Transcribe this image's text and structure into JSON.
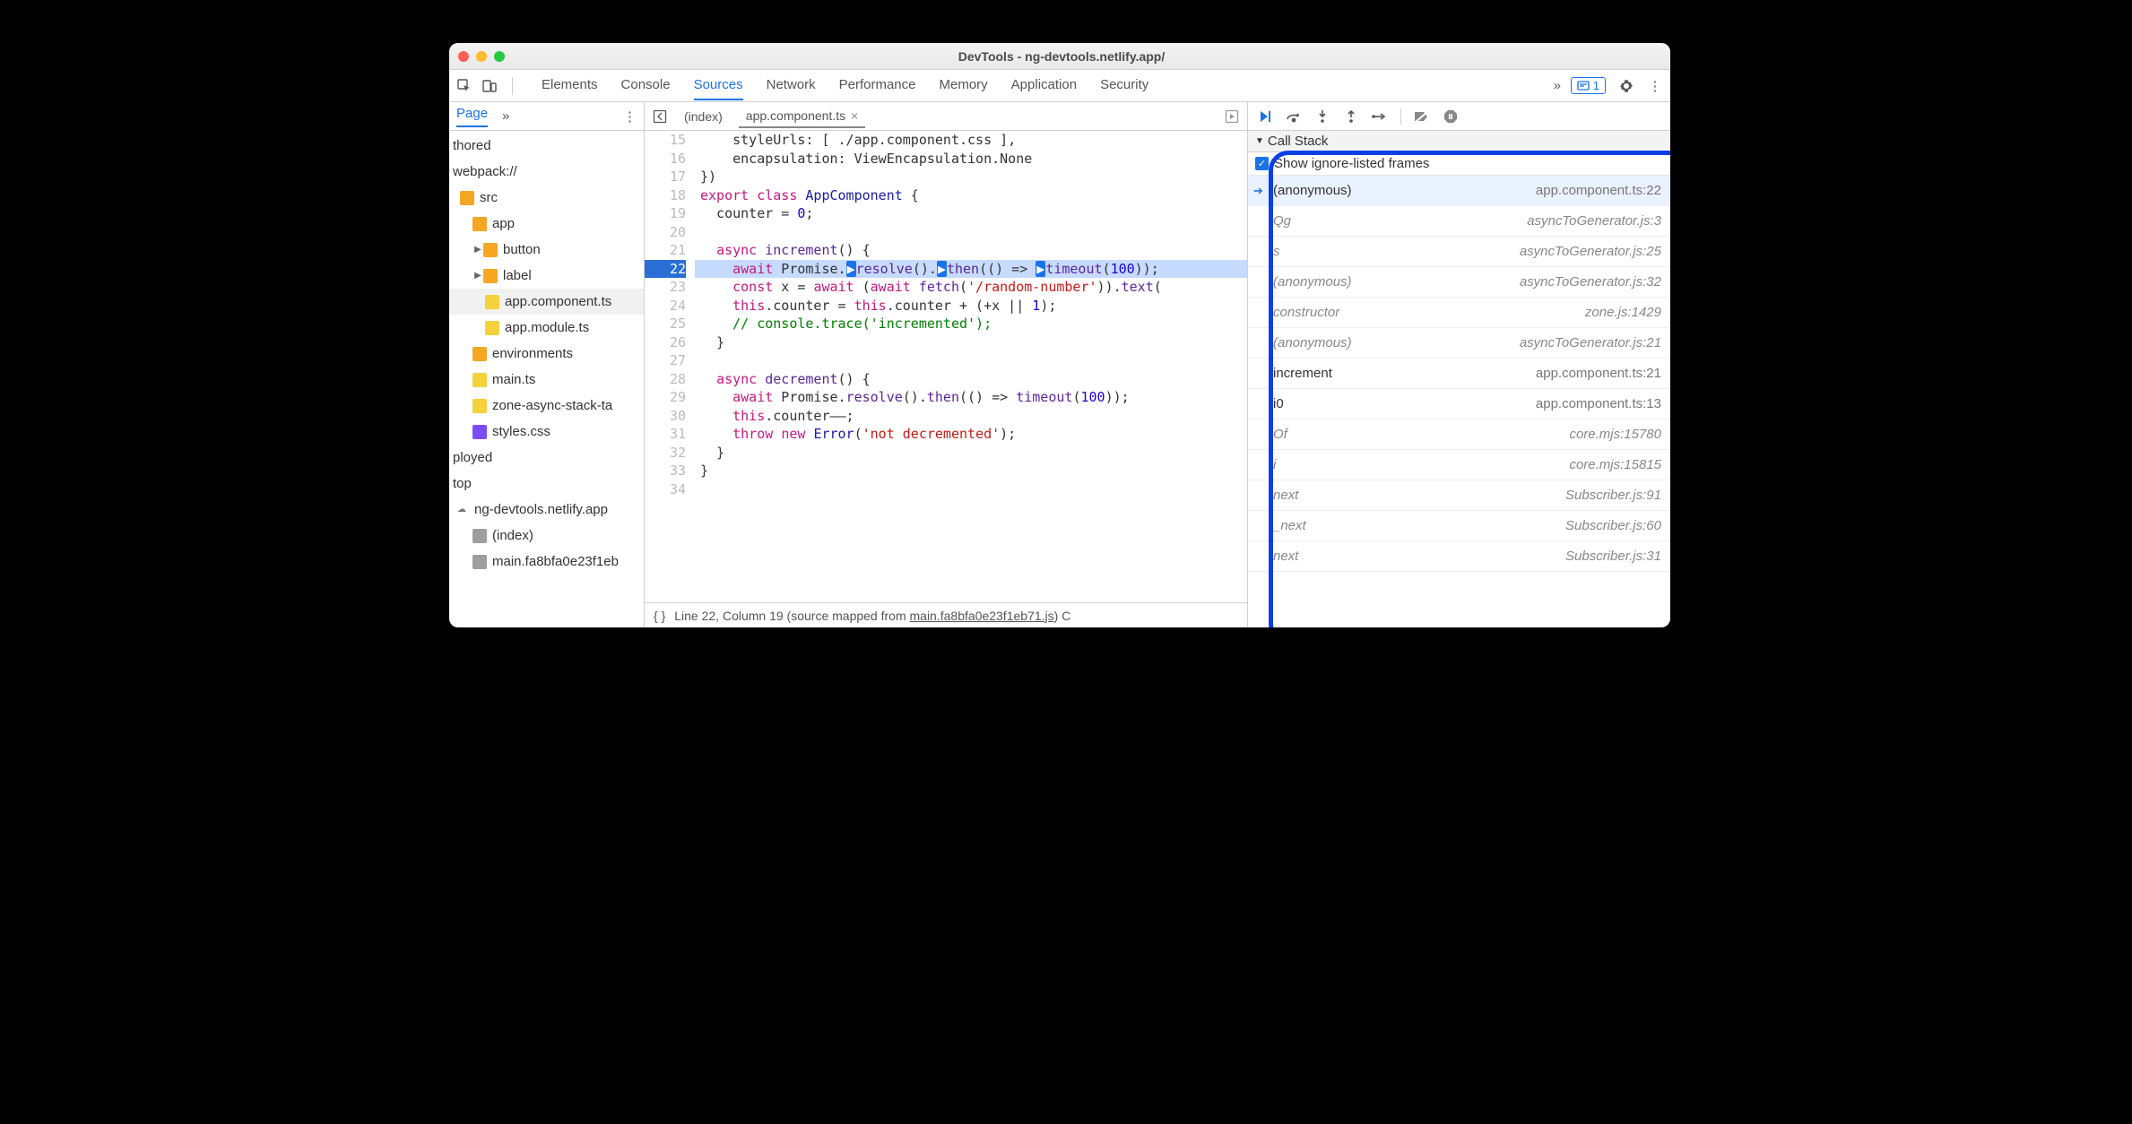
{
  "window": {
    "title": "DevTools - ng-devtools.netlify.app/"
  },
  "mainTabs": [
    "Elements",
    "Console",
    "Sources",
    "Network",
    "Performance",
    "Memory",
    "Application",
    "Security"
  ],
  "activeMainTab": "Sources",
  "issuesCount": "1",
  "navTabs": {
    "active": "Page"
  },
  "tree": {
    "authored": "thored",
    "webpack": "webpack://",
    "folders": {
      "src": "src",
      "app": "app",
      "button": "button",
      "label": "label",
      "environments": "environments"
    },
    "files": {
      "app_component": "app.component.ts",
      "app_module": "app.module.ts",
      "main_ts": "main.ts",
      "zone_stack": "zone-async-stack-ta",
      "styles_css": "styles.css",
      "index": "(index)",
      "main_hash": "main.fa8bfa0e23f1eb"
    },
    "ployed": "ployed",
    "top": "top",
    "domain": "ng-devtools.netlify.app"
  },
  "editor": {
    "tabs": {
      "index": "(index)",
      "active": "app.component.ts"
    },
    "startLine": 15,
    "currentLineIdx": 7,
    "lines": [
      {
        "html": "&nbsp;&nbsp;&nbsp;&nbsp;styleUrls: [&nbsp;./app.component.css&nbsp;],"
      },
      {
        "html": "&nbsp;&nbsp;&nbsp;&nbsp;encapsulation: ViewEncapsulation.None"
      },
      {
        "html": "})"
      },
      {
        "html": "<span class='kw'>export</span> <span class='kw'>class</span> <span class='cls'>AppComponent</span> {"
      },
      {
        "html": "&nbsp;&nbsp;counter = <span class='num'>0</span>;"
      },
      {
        "html": ""
      },
      {
        "html": "&nbsp;&nbsp;<span class='kw'>async</span> <span class='fn'>increment</span>() {"
      },
      {
        "html": "&nbsp;&nbsp;&nbsp;&nbsp;<span class='kw'>await</span> Promise.<span class='mark'>▶</span><span class='fn'>resolve</span>().<span class='mark'>▶</span><span class='fn'>then</span>(() =&gt; <span class='mark'>▶</span><span class='fn'>timeout</span>(<span class='num'>100</span>));"
      },
      {
        "html": "&nbsp;&nbsp;&nbsp;&nbsp;<span class='kw'>const</span> x = <span class='kw'>await</span> (<span class='kw'>await</span> <span class='fn'>fetch</span>(<span class='str'>'/random-number'</span>)).<span class='fn'>text</span>("
      },
      {
        "html": "&nbsp;&nbsp;&nbsp;&nbsp;<span class='kw'>this</span>.counter = <span class='kw'>this</span>.counter + (+x || <span class='num'>1</span>);"
      },
      {
        "html": "&nbsp;&nbsp;&nbsp;&nbsp;<span class='cmt'>// console.trace('incremented');</span>"
      },
      {
        "html": "&nbsp;&nbsp;}"
      },
      {
        "html": ""
      },
      {
        "html": "&nbsp;&nbsp;<span class='kw'>async</span> <span class='fn'>decrement</span>() {"
      },
      {
        "html": "&nbsp;&nbsp;&nbsp;&nbsp;<span class='kw'>await</span> Promise.<span class='fn'>resolve</span>().<span class='fn'>then</span>(() =&gt; <span class='fn'>timeout</span>(<span class='num'>100</span>));"
      },
      {
        "html": "&nbsp;&nbsp;&nbsp;&nbsp;<span class='kw'>this</span>.counter––;"
      },
      {
        "html": "&nbsp;&nbsp;&nbsp;&nbsp;<span class='kw'>throw</span> <span class='kw'>new</span> <span class='cls'>Error</span>(<span class='str'>'not decremented'</span>);"
      },
      {
        "html": "&nbsp;&nbsp;}"
      },
      {
        "html": "}"
      },
      {
        "html": ""
      }
    ],
    "status": {
      "prefix": "Line 22, Column 19  (source mapped from ",
      "link": "main.fa8bfa0e23f1eb71.js",
      "suffix": ") C"
    }
  },
  "debugger": {
    "callStackTitle": "Call Stack",
    "showIgnoredLabel": "Show ignore-listed frames",
    "frames": [
      {
        "name": "(anonymous)",
        "loc": "app.component.ts:22",
        "current": true,
        "ignored": false
      },
      {
        "name": "Qg",
        "loc": "asyncToGenerator.js:3",
        "ignored": true
      },
      {
        "name": "s",
        "loc": "asyncToGenerator.js:25",
        "ignored": true
      },
      {
        "name": "(anonymous)",
        "loc": "asyncToGenerator.js:32",
        "ignored": true
      },
      {
        "name": "constructor",
        "loc": "zone.js:1429",
        "ignored": true
      },
      {
        "name": "(anonymous)",
        "loc": "asyncToGenerator.js:21",
        "ignored": true
      },
      {
        "name": "increment",
        "loc": "app.component.ts:21",
        "ignored": false
      },
      {
        "name": "i0",
        "loc": "app.component.ts:13",
        "ignored": false
      },
      {
        "name": "Of",
        "loc": "core.mjs:15780",
        "ignored": true
      },
      {
        "name": "i",
        "loc": "core.mjs:15815",
        "ignored": true
      },
      {
        "name": "next",
        "loc": "Subscriber.js:91",
        "ignored": true
      },
      {
        "name": "_next",
        "loc": "Subscriber.js:60",
        "ignored": true
      },
      {
        "name": "next",
        "loc": "Subscriber.js:31",
        "ignored": true
      }
    ]
  }
}
